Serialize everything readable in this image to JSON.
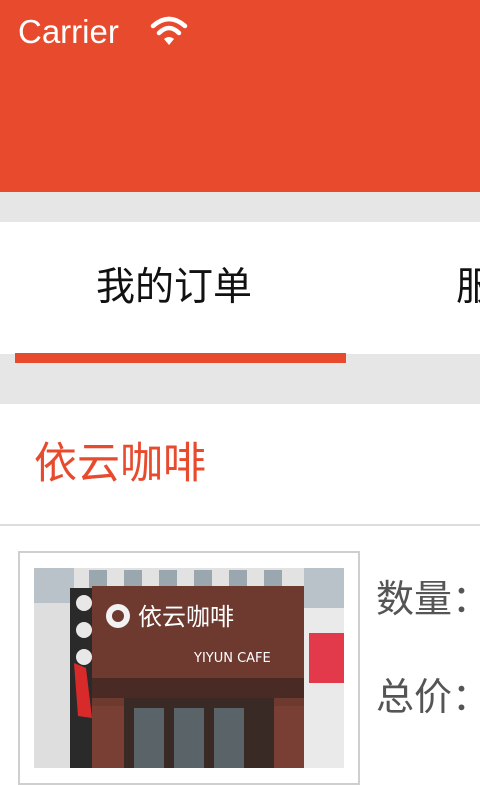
{
  "status_bar": {
    "carrier": "Carrier",
    "wifi_icon": "wifi-icon",
    "background": "#e84a2e"
  },
  "tabs": [
    {
      "label": "我的订单",
      "selected": true
    },
    {
      "label": "服"
    }
  ],
  "accent_color": "#e84a2e",
  "order": {
    "shop_name": "依云咖啡",
    "image": {
      "sign_text": "依云咖啡",
      "sign_subtext": "YIYUN CAFE"
    },
    "quantity_label": "数量：",
    "total_price_label": "总价："
  }
}
